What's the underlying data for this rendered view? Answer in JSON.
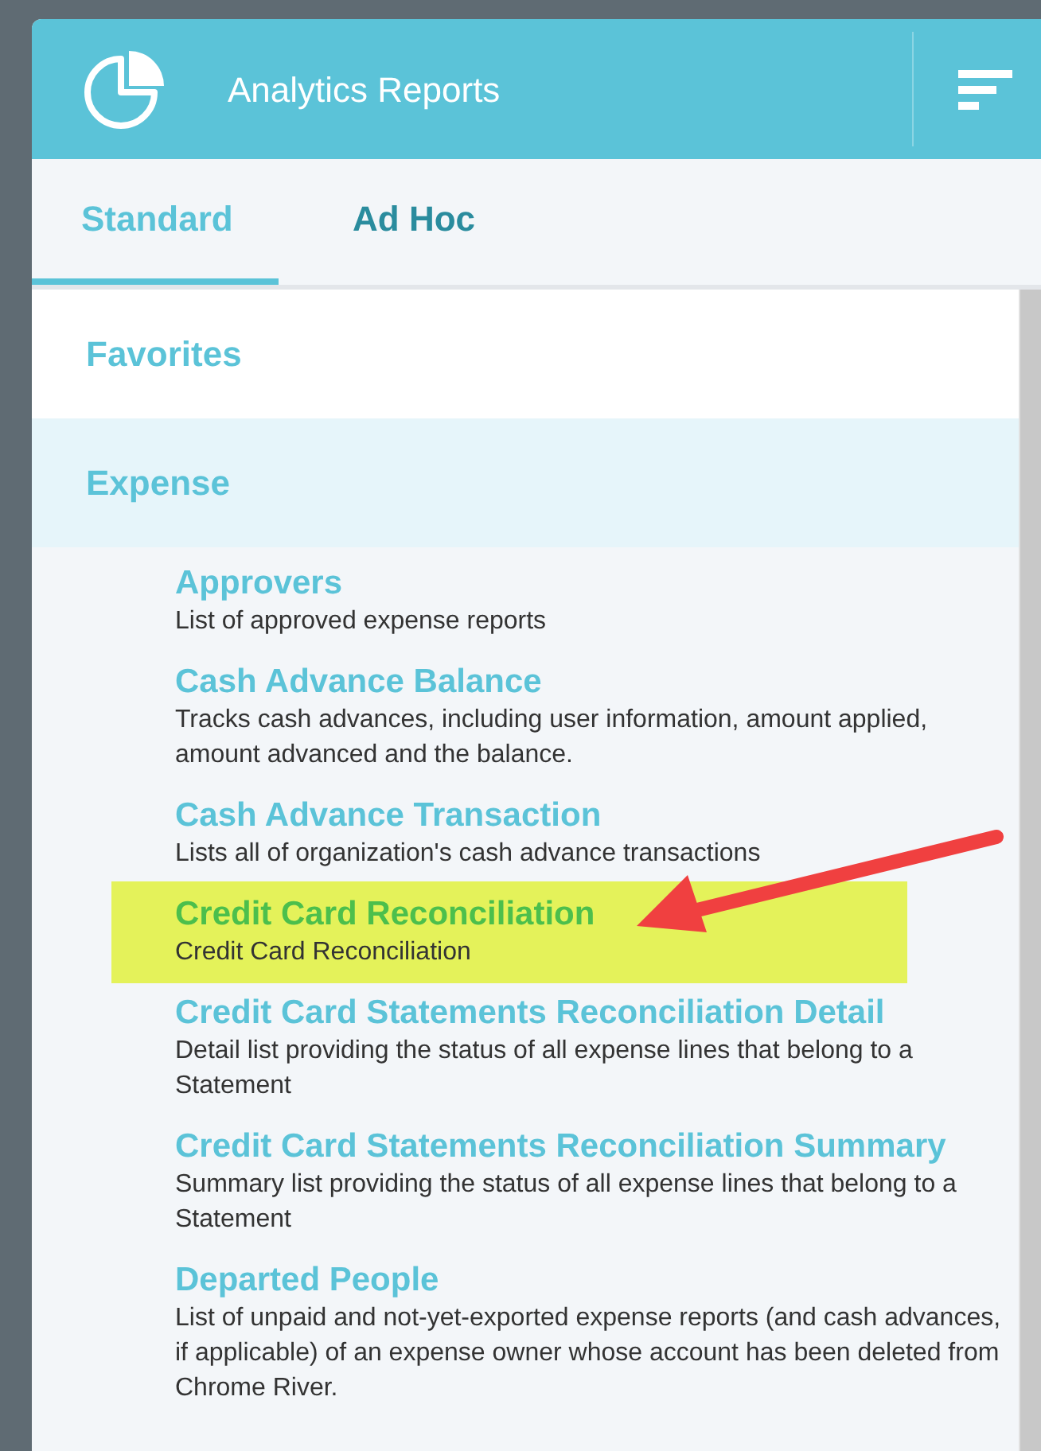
{
  "header": {
    "title": "Analytics Reports"
  },
  "tabs": [
    {
      "label": "Standard",
      "selected": true
    },
    {
      "label": "Ad Hoc",
      "selected": false
    }
  ],
  "categories": [
    {
      "label": "Favorites",
      "expanded": false
    },
    {
      "label": "Expense",
      "expanded": true
    }
  ],
  "reports": [
    {
      "title": "Approvers",
      "description": "List of approved expense reports",
      "highlighted": false
    },
    {
      "title": "Cash Advance Balance",
      "description": "Tracks cash advances, including user information, amount applied, amount advanced and the balance.",
      "highlighted": false
    },
    {
      "title": "Cash Advance Transaction",
      "description": "Lists all of organization's cash advance transactions",
      "highlighted": false
    },
    {
      "title": "Credit Card Reconciliation",
      "description": "Credit Card Reconciliation",
      "highlighted": true
    },
    {
      "title": "Credit Card Statements Reconciliation Detail",
      "description": "Detail list providing the status of all expense lines that belong to a Statement",
      "highlighted": false
    },
    {
      "title": "Credit Card Statements Reconciliation Summary",
      "description": "Summary list providing the status of all expense lines that belong to a Statement",
      "highlighted": false
    },
    {
      "title": "Departed People",
      "description": "List of unpaid and not-yet-exported expense reports (and cash advances, if applicable) of an expense owner whose account has been deleted from Chrome River.",
      "highlighted": false
    }
  ]
}
